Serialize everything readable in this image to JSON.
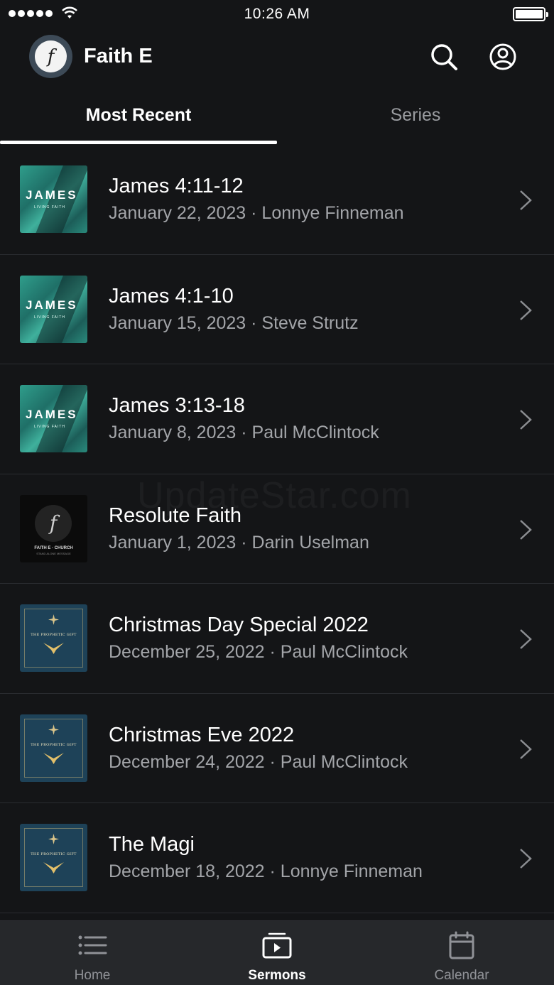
{
  "status_bar": {
    "time": "10:26 AM"
  },
  "header": {
    "title": "Faith E",
    "logo_letter": "f"
  },
  "tabs": [
    {
      "label": "Most Recent",
      "active": true
    },
    {
      "label": "Series",
      "active": false
    }
  ],
  "sermons": [
    {
      "title": "James 4:11-12",
      "subtitle": "January 22, 2023 · Lonnye Finneman",
      "thumb": "james",
      "thumb_text": "JAMES",
      "thumb_sub": "LIVING FAITH"
    },
    {
      "title": "James 4:1-10",
      "subtitle": "January 15, 2023 · Steve Strutz",
      "thumb": "james",
      "thumb_text": "JAMES",
      "thumb_sub": "LIVING FAITH"
    },
    {
      "title": "James 3:13-18",
      "subtitle": "January 8, 2023 · Paul McClintock",
      "thumb": "james",
      "thumb_text": "JAMES",
      "thumb_sub": "LIVING FAITH"
    },
    {
      "title": "Resolute Faith",
      "subtitle": "January 1, 2023 · Darin Uselman",
      "thumb": "faith",
      "thumb_text": "FAITH E · CHURCH",
      "thumb_sub": "STAND ALONE MESSAGE"
    },
    {
      "title": "Christmas Day Special 2022",
      "subtitle": "December 25, 2022 · Paul McClintock",
      "thumb": "gift",
      "thumb_text": "THE PROPHETIC GIFT",
      "thumb_sub": ""
    },
    {
      "title": "Christmas Eve 2022",
      "subtitle": "December 24, 2022 · Paul McClintock",
      "thumb": "gift",
      "thumb_text": "THE PROPHETIC GIFT",
      "thumb_sub": ""
    },
    {
      "title": "The Magi",
      "subtitle": "December 18, 2022 · Lonnye Finneman",
      "thumb": "gift",
      "thumb_text": "THE PROPHETIC GIFT",
      "thumb_sub": ""
    }
  ],
  "bottom_nav": [
    {
      "label": "Home",
      "icon": "list-icon",
      "active": false
    },
    {
      "label": "Sermons",
      "icon": "sermons-icon",
      "active": true
    },
    {
      "label": "Calendar",
      "icon": "calendar-icon",
      "active": false
    }
  ],
  "watermark": "UpdateStar.com"
}
